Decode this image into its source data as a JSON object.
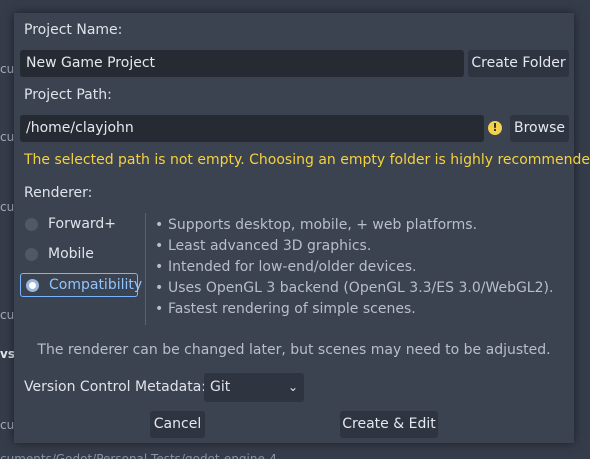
{
  "background": {
    "left_fragments": [
      "cu",
      "cu",
      "cu",
      "cu",
      "vs",
      "cu"
    ],
    "bottom_text": "cuments/Godot/Personal Tests/godot-engine-4"
  },
  "dialog": {
    "project_name_label": "Project Name:",
    "project_name_value": "New Game Project",
    "create_folder_label": "Create Folder",
    "project_path_label": "Project Path:",
    "project_path_value": "/home/clayjohn",
    "warning_icon": "exclamation-warning-icon",
    "warning_icon_glyph": "!",
    "browse_label": "Browse",
    "warning_text": "The selected path is not empty. Choosing an empty folder is highly recommended.",
    "renderer_label": "Renderer:",
    "renderers": [
      {
        "label": "Forward+",
        "selected": false
      },
      {
        "label": "Mobile",
        "selected": false
      },
      {
        "label": "Compatibility",
        "selected": true
      }
    ],
    "bullet_glyph": "•",
    "renderer_description": [
      "Supports desktop, mobile, + web platforms.",
      "Least advanced 3D graphics.",
      "Intended for low-end/older devices.",
      "Uses OpenGL 3 backend (OpenGL 3.3/ES 3.0/WebGL2).",
      "Fastest rendering of simple scenes."
    ],
    "renderer_note": "The renderer can be changed later, but scenes may need to be adjusted.",
    "vcs_label": "Version Control Metadata:",
    "vcs_selected": "Git",
    "vcs_chevron_glyph": "⌄",
    "cancel_label": "Cancel",
    "create_edit_label": "Create & Edit"
  },
  "colors": {
    "warning": "#f5d23e",
    "accent": "#77b6ff",
    "dialog_bg": "#3b4250"
  }
}
